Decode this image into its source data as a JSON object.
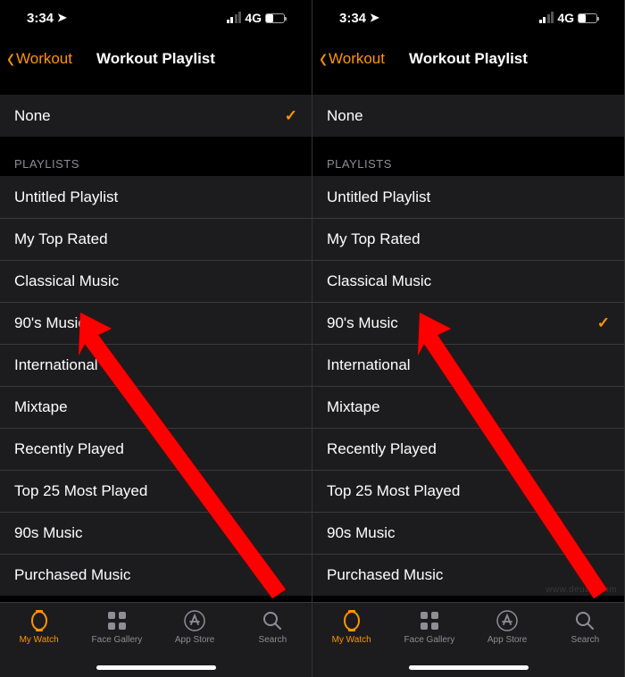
{
  "status": {
    "time": "3:34",
    "location_indicator": "➤",
    "network": "4G"
  },
  "nav": {
    "back_label": "Workout",
    "title": "Workout Playlist"
  },
  "none_row": {
    "label": "None",
    "check": "✓"
  },
  "section": {
    "header": "PLAYLISTS"
  },
  "playlists": [
    "Untitled Playlist",
    "My Top Rated",
    "Classical Music",
    "90's Music",
    "International",
    "Mixtape",
    "Recently Played",
    "Top 25 Most Played",
    "90s Music",
    "Purchased Music"
  ],
  "tabs": {
    "my_watch": "My Watch",
    "face_gallery": "Face Gallery",
    "app_store": "App Store",
    "search": "Search"
  },
  "left_selected_index": -1,
  "right_selected_index": 3,
  "left_none_selected": true,
  "right_none_selected": false,
  "watermark": "www.deuaq.com"
}
